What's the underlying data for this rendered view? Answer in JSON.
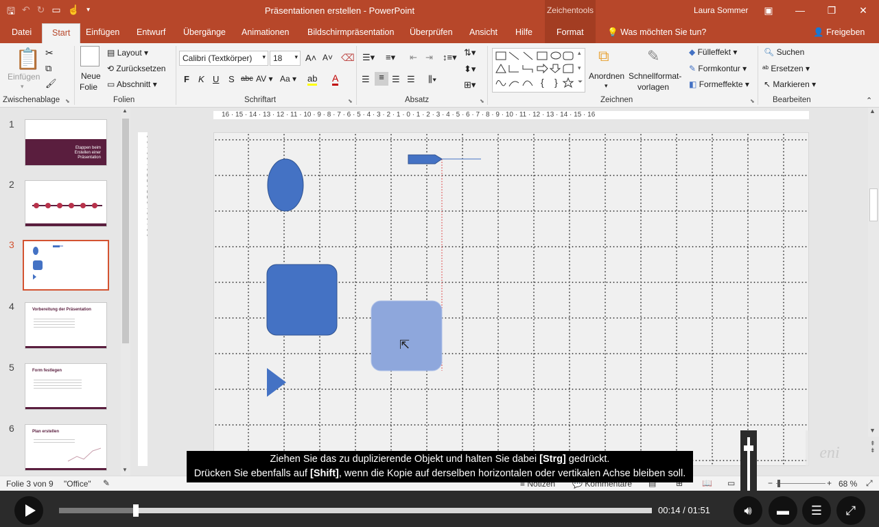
{
  "window": {
    "title": "Präsentationen erstellen - PowerPoint",
    "context_tools": "Zeichentools",
    "user": "Laura Sommer"
  },
  "tabs": [
    "Datei",
    "Start",
    "Einfügen",
    "Entwurf",
    "Übergänge",
    "Animationen",
    "Bildschirmpräsentation",
    "Überprüfen",
    "Ansicht",
    "Hilfe",
    "Format"
  ],
  "tellme": "Was möchten Sie tun?",
  "share": "Freigeben",
  "ribbon": {
    "clipboard": {
      "paste": "Einfügen",
      "label": "Zwischenablage"
    },
    "slides": {
      "new_slide_1": "Neue",
      "new_slide_2": "Folie",
      "layout": "Layout",
      "reset": "Zurücksetzen",
      "section": "Abschnitt",
      "label": "Folien"
    },
    "font": {
      "font_name": "Calibri (Textkörper)",
      "font_size": "18",
      "label": "Schriftart"
    },
    "paragraph": {
      "label": "Absatz"
    },
    "drawing": {
      "arrange": "Anordnen",
      "quickstyles_1": "Schnellformat-",
      "quickstyles_2": "vorlagen",
      "fill": "Fülleffekt",
      "outline": "Formkontur",
      "effects": "Formeffekte",
      "label": "Zeichnen"
    },
    "editing": {
      "find": "Suchen",
      "replace": "Ersetzen",
      "select": "Markieren",
      "label": "Bearbeiten"
    }
  },
  "thumbnails": [
    {
      "num": "1",
      "title": "Etappen beim Erstellen einer Präsentation"
    },
    {
      "num": "2",
      "title": ""
    },
    {
      "num": "3",
      "title": ""
    },
    {
      "num": "4",
      "title": "Vorbereitung der Präsentation"
    },
    {
      "num": "5",
      "title": "Form festlegen"
    },
    {
      "num": "6",
      "title": "Plan erstellen"
    }
  ],
  "status": {
    "slide": "Folie 3 von 9",
    "theme": "\"Office\"",
    "notes": "Notizen",
    "comments": "Kommentare",
    "zoom": "68 %"
  },
  "caption": {
    "line1_a": "Ziehen Sie das zu duplizierende Objekt und halten Sie dabei ",
    "line1_key": "[Strg]",
    "line1_b": " gedrückt.",
    "line2_a": "Drücken Sie ebenfalls auf ",
    "line2_key": "[Shift]",
    "line2_b": ", wenn die Kopie auf derselben horizontalen oder vertikalen Achse bleiben soll."
  },
  "player": {
    "time": "00:14 / 01:51",
    "progress": 0.13
  },
  "colors": {
    "accent": "#b7472a",
    "shape": "#4472c4",
    "shape_copy": "#8ea7dc"
  }
}
